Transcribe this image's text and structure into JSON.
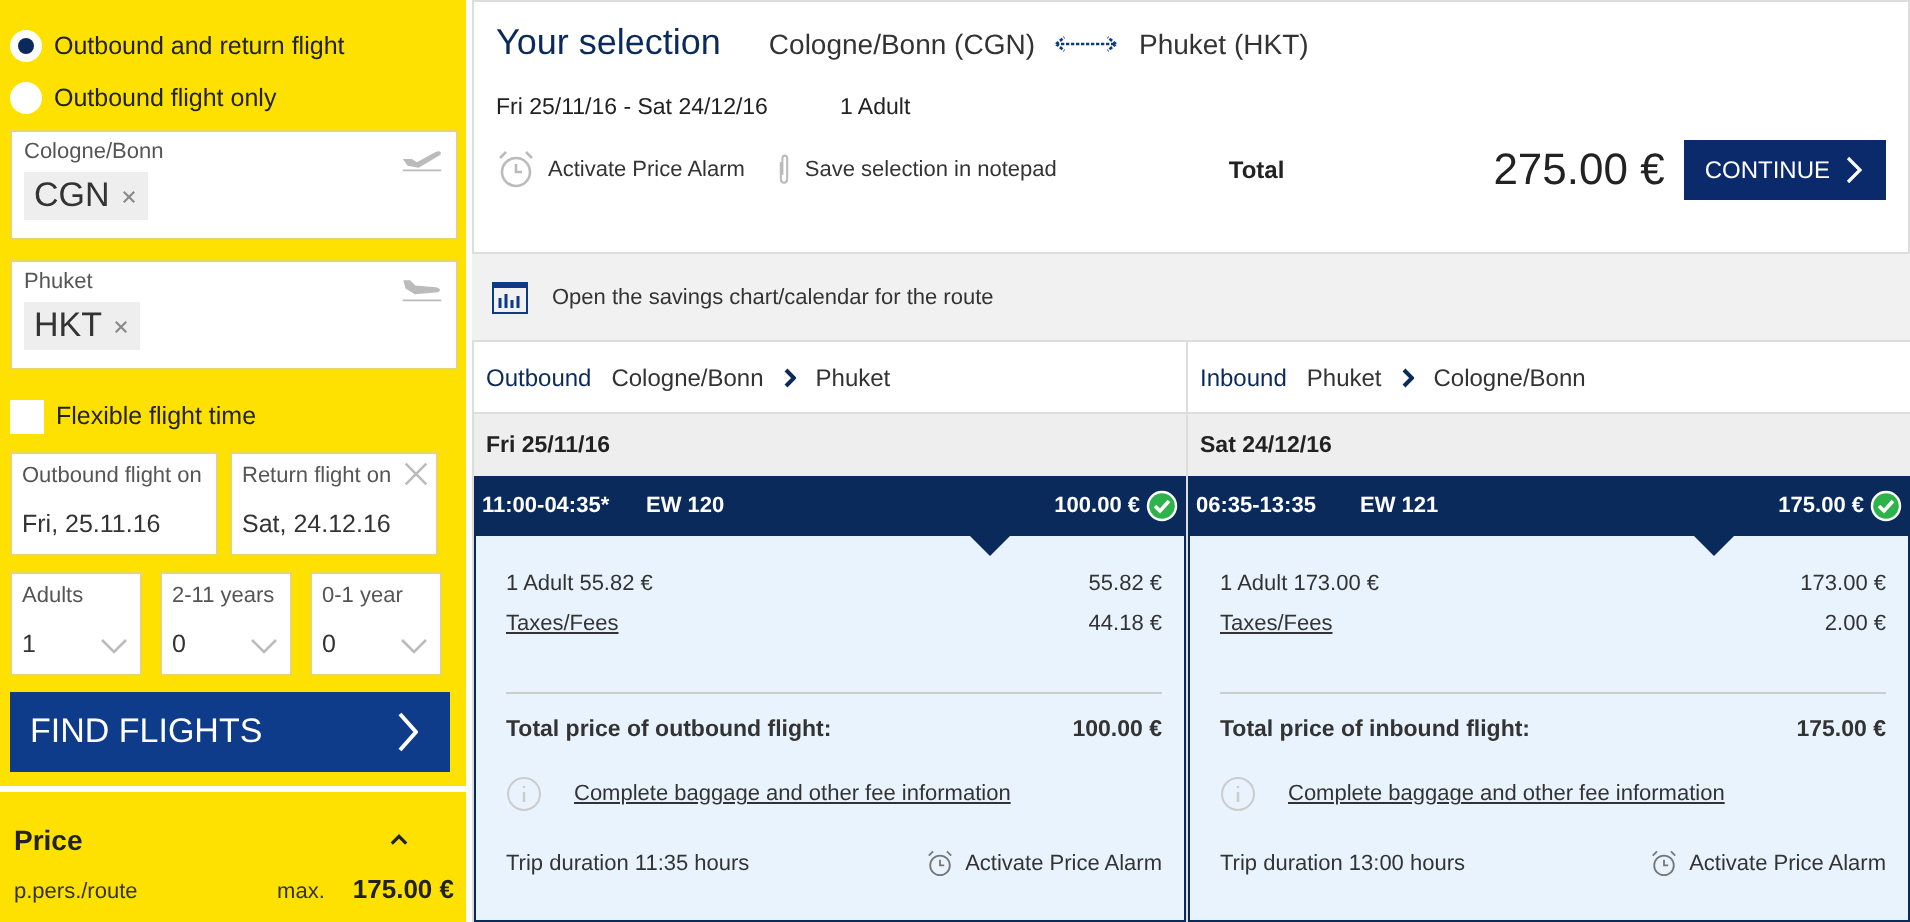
{
  "trip_type": [
    {
      "label": "Outbound and return flight",
      "selected": true
    },
    {
      "label": "Outbound flight only",
      "selected": false
    }
  ],
  "airports": [
    {
      "kind": "departure",
      "label": "Cologne/Bonn",
      "code": "CGN"
    },
    {
      "kind": "arrival",
      "label": "Phuket",
      "code": "HKT"
    }
  ],
  "flexible_flight_time": {
    "label": "Flexible flight time",
    "checked": false
  },
  "dates": [
    {
      "label": "Outbound flight on",
      "value": "Fri, 25.11.16",
      "clearable": false
    },
    {
      "label": "Return flight on",
      "value": "Sat, 24.12.16",
      "clearable": true
    }
  ],
  "passengers": [
    {
      "label": "Adults",
      "value": "1"
    },
    {
      "label": "2-11 years",
      "value": "0"
    },
    {
      "label": "0-1 year",
      "value": "0"
    }
  ],
  "find_button": "FIND FLIGHTS",
  "price_filter": {
    "title": "Price",
    "expanded": true,
    "per_label": "p.pers./route",
    "max_label": "max.",
    "max_value": "175.00 €"
  },
  "selection": {
    "title": "Your selection",
    "from": "Cologne/Bonn (CGN)",
    "to": "Phuket (HKT)",
    "dates": "Fri 25/11/16 - Sat 24/12/16",
    "travellers": "1 Adult",
    "alarm": "Activate Price Alarm",
    "notepad": "Save selection in notepad",
    "total_label": "Total",
    "total": "275.00 €",
    "continue": "CONTINUE"
  },
  "savings_link": "Open the savings chart/calendar for the route",
  "legs": [
    {
      "direction": "Outbound",
      "from": "Cologne/Bonn",
      "to": "Phuket",
      "date": "Fri 25/11/16",
      "times": "11:00-04:35*",
      "flight": "EW 120",
      "price": "100.00 €",
      "selected": true,
      "lines": [
        {
          "label": "1 Adult 55.82 €",
          "value": "55.82 €",
          "link": false
        },
        {
          "label": "Taxes/Fees",
          "value": "44.18 €",
          "link": true
        }
      ],
      "total_label": "Total price of outbound flight:",
      "total": "100.00 €",
      "info": "Complete baggage and other fee information",
      "duration": "Trip duration 11:35  hours",
      "alarm": "Activate Price Alarm"
    },
    {
      "direction": "Inbound",
      "from": "Phuket",
      "to": "Cologne/Bonn",
      "date": "Sat 24/12/16",
      "times": "06:35-13:35",
      "flight": "EW 121",
      "price": "175.00 €",
      "selected": true,
      "lines": [
        {
          "label": "1 Adult 173.00 €",
          "value": "173.00 €",
          "link": false
        },
        {
          "label": "Taxes/Fees",
          "value": "2.00 €",
          "link": true
        }
      ],
      "total_label": "Total price of inbound flight:",
      "total": "175.00 €",
      "info": "Complete baggage and other fee information",
      "duration": "Trip duration 13:00  hours",
      "alarm": "Activate Price Alarm"
    }
  ]
}
